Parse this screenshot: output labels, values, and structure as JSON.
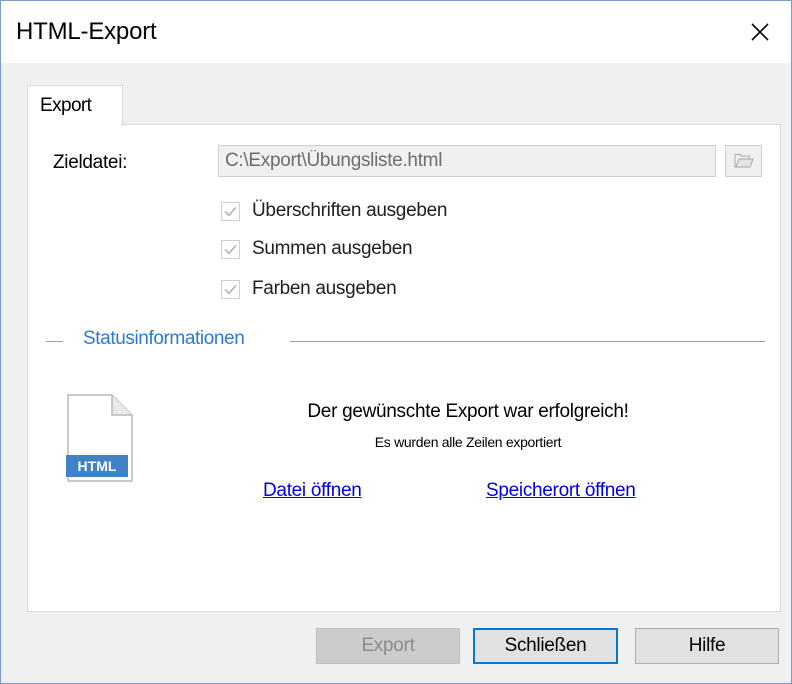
{
  "window": {
    "title": "HTML-Export"
  },
  "tabs": [
    {
      "label": "Export",
      "selected": true
    }
  ],
  "target": {
    "label": "Zieldatei:",
    "value": "C:\\Export\\Übungsliste.html"
  },
  "options": [
    {
      "label": "Überschriften ausgeben",
      "checked": true,
      "enabled": false
    },
    {
      "label": "Summen ausgeben",
      "checked": true,
      "enabled": false
    },
    {
      "label": "Farben ausgeben",
      "checked": true,
      "enabled": false
    }
  ],
  "status": {
    "section_title": "Statusinformationen",
    "icon_label": "HTML",
    "message": "Der gewünschte Export war erfolgreich!",
    "detail": "Es wurden alle Zeilen exportiert",
    "open_file_link": "Datei öffnen",
    "open_location_link": "Speicherort öffnen"
  },
  "buttons": {
    "export": "Export",
    "close": "Schließen",
    "help": "Hilfe"
  },
  "colors": {
    "accent": "#0078d7",
    "section_title": "#2a7bd1",
    "link": "#0000e6",
    "icon_badge": "#3f82c6"
  }
}
